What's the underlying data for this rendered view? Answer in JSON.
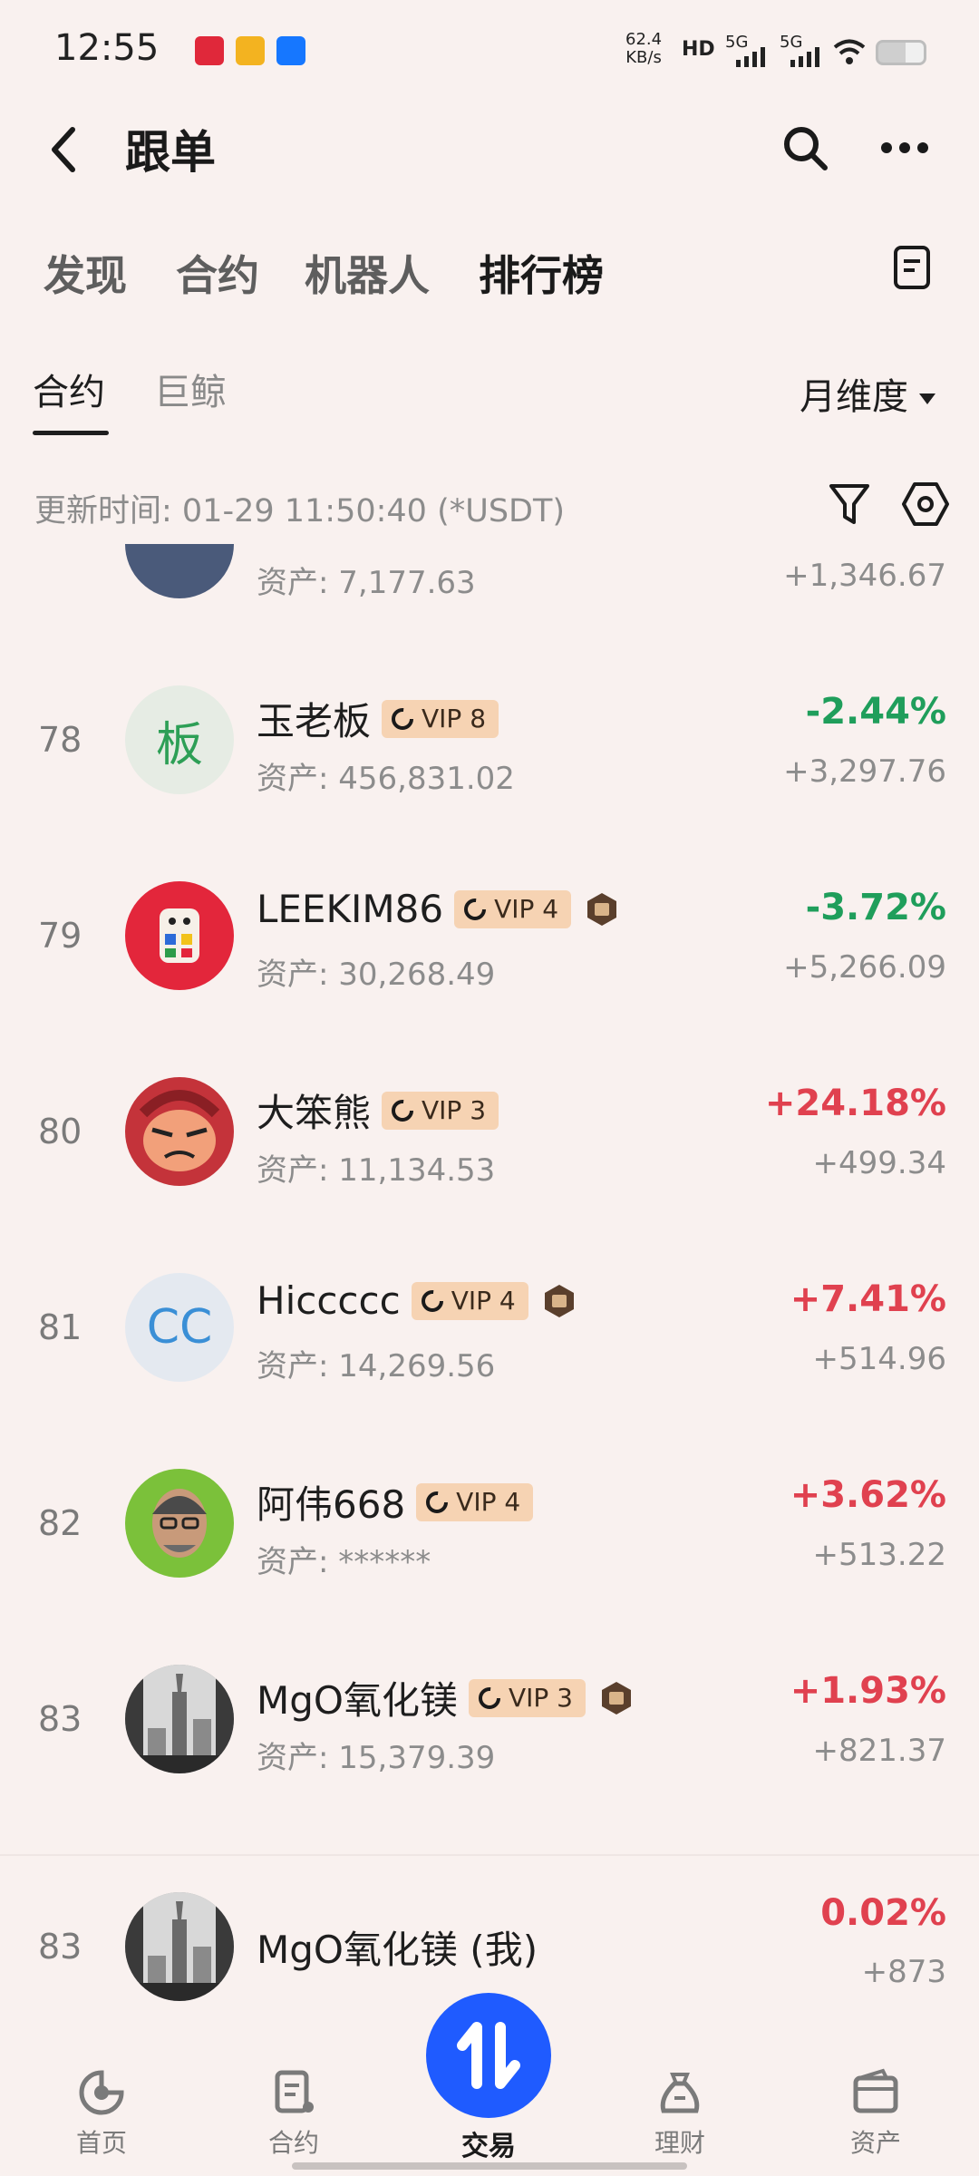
{
  "status_bar": {
    "time": "12:55",
    "net_speed_value": "62.4",
    "net_speed_unit": "KB/s",
    "hd": "HD",
    "sig1": "5G",
    "sig2": "5G"
  },
  "header": {
    "title": "跟单"
  },
  "top_tabs": [
    {
      "label": "发现"
    },
    {
      "label": "合约"
    },
    {
      "label": "机器人"
    },
    {
      "label": "排行榜"
    }
  ],
  "sub_tabs": [
    {
      "label": "合约"
    },
    {
      "label": "巨鲸"
    }
  ],
  "period": "月维度",
  "update_time": "更新时间: 01-29 11:50:40 (*USDT)",
  "partial_row": {
    "asset": "资产: 7,177.63",
    "pnl": "+1,346.67"
  },
  "rows": [
    {
      "rank": "78",
      "name": "玉老板",
      "vip": "VIP 8",
      "medal": false,
      "asset": "资产: 456,831.02",
      "pct": "-2.44%",
      "pnl": "+3,297.76",
      "avatar_text": "板",
      "avatar_bg": "#e6ece4",
      "avatar_fg": "#2d9f56"
    },
    {
      "rank": "79",
      "name": "LEEKIM86",
      "vip": "VIP 4",
      "medal": true,
      "asset": "资产: 30,268.49",
      "pct": "-3.72%",
      "pnl": "+5,266.09",
      "avatar_text": "",
      "avatar_bg": "#e3263b",
      "avatar_fg": "#ffffff"
    },
    {
      "rank": "80",
      "name": "大笨熊",
      "vip": "VIP 3",
      "medal": false,
      "asset": "资产: 11,134.53",
      "pct": "+24.18%",
      "pnl": "+499.34",
      "avatar_text": "",
      "avatar_bg": "#c4333a",
      "avatar_fg": "#ffffff"
    },
    {
      "rank": "81",
      "name": "Hiccccc",
      "vip": "VIP 4",
      "medal": true,
      "asset": "资产: 14,269.56",
      "pct": "+7.41%",
      "pnl": "+514.96",
      "avatar_text": "CC",
      "avatar_bg": "#e4e9f0",
      "avatar_fg": "#3a8fd6"
    },
    {
      "rank": "82",
      "name": "阿伟668",
      "vip": "VIP 4",
      "medal": false,
      "asset": "资产: ******",
      "pct": "+3.62%",
      "pnl": "+513.22",
      "avatar_text": "",
      "avatar_bg": "#7bc13a",
      "avatar_fg": "#ffffff"
    },
    {
      "rank": "83",
      "name": "MgO氧化镁",
      "vip": "VIP 3",
      "medal": true,
      "asset": "资产: 15,379.39",
      "pct": "+1.93%",
      "pnl": "+821.37",
      "avatar_text": "",
      "avatar_bg": "#9b9b9b",
      "avatar_fg": "#ffffff"
    }
  ],
  "my_row": {
    "rank": "83",
    "name": "MgO氧化镁 (我)",
    "pct": "0.02%",
    "pnl": "+873"
  },
  "bottom_nav": [
    {
      "label": "首页"
    },
    {
      "label": "合约"
    },
    {
      "label": "交易"
    },
    {
      "label": "理财"
    },
    {
      "label": "资产"
    }
  ],
  "colors": {
    "background": "#f9f1ef",
    "negative": "#1f9e5b",
    "positive": "#e0414f",
    "accent": "#1f5bff",
    "vip_badge": "#f6d3b3"
  }
}
